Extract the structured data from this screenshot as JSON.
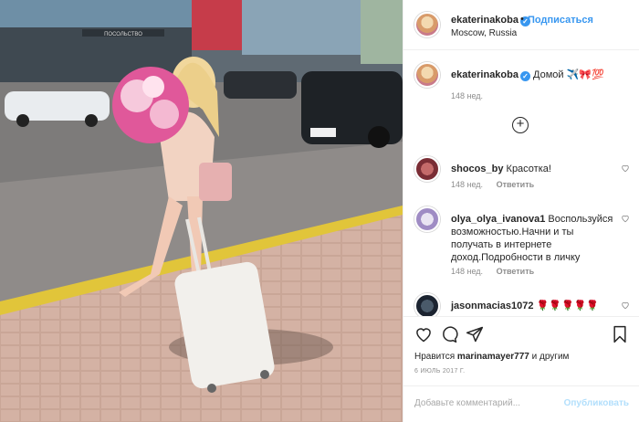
{
  "header": {
    "username": "ekaterinakoba",
    "verified_glyph": "✓",
    "separator": "•",
    "follow_label": "Подписаться",
    "location": "Moscow, Russia",
    "more_glyph": "•••"
  },
  "caption": {
    "username": "ekaterinakoba",
    "text": "Домой ✈️🎀💯",
    "age": "148 нед."
  },
  "load_more_glyph": "+",
  "comments": [
    {
      "username": "shocos_by",
      "text": "Красотка!",
      "age": "148 нед.",
      "reply": "Ответить"
    },
    {
      "username": "olya_olya_ivanova1",
      "text": "Воспользуйся возможностью.Начни и ты получать в интернете доход.Подробности в личку",
      "age": "148 нед.",
      "reply": "Ответить"
    },
    {
      "username": "jasonmacias1072",
      "text": "🌹🌹🌹🌹🌹",
      "age": "",
      "reply": ""
    }
  ],
  "likes": {
    "prefix": "Нравится",
    "user": "marinamayer777",
    "suffix": "и другим"
  },
  "date": "6 ИЮЛЬ 2017 Г.",
  "add_comment": {
    "placeholder": "Добавьте комментарий...",
    "publish_label": "Опубликовать"
  },
  "photo_sign_text": "ПОСОЛЬСТВО",
  "colors": {
    "accent": "#3897f0",
    "muted": "#8e8e8e",
    "publish_disabled": "#b2dffc"
  },
  "icons": [
    "heart-icon",
    "comment-icon",
    "share-icon",
    "bookmark-icon"
  ]
}
